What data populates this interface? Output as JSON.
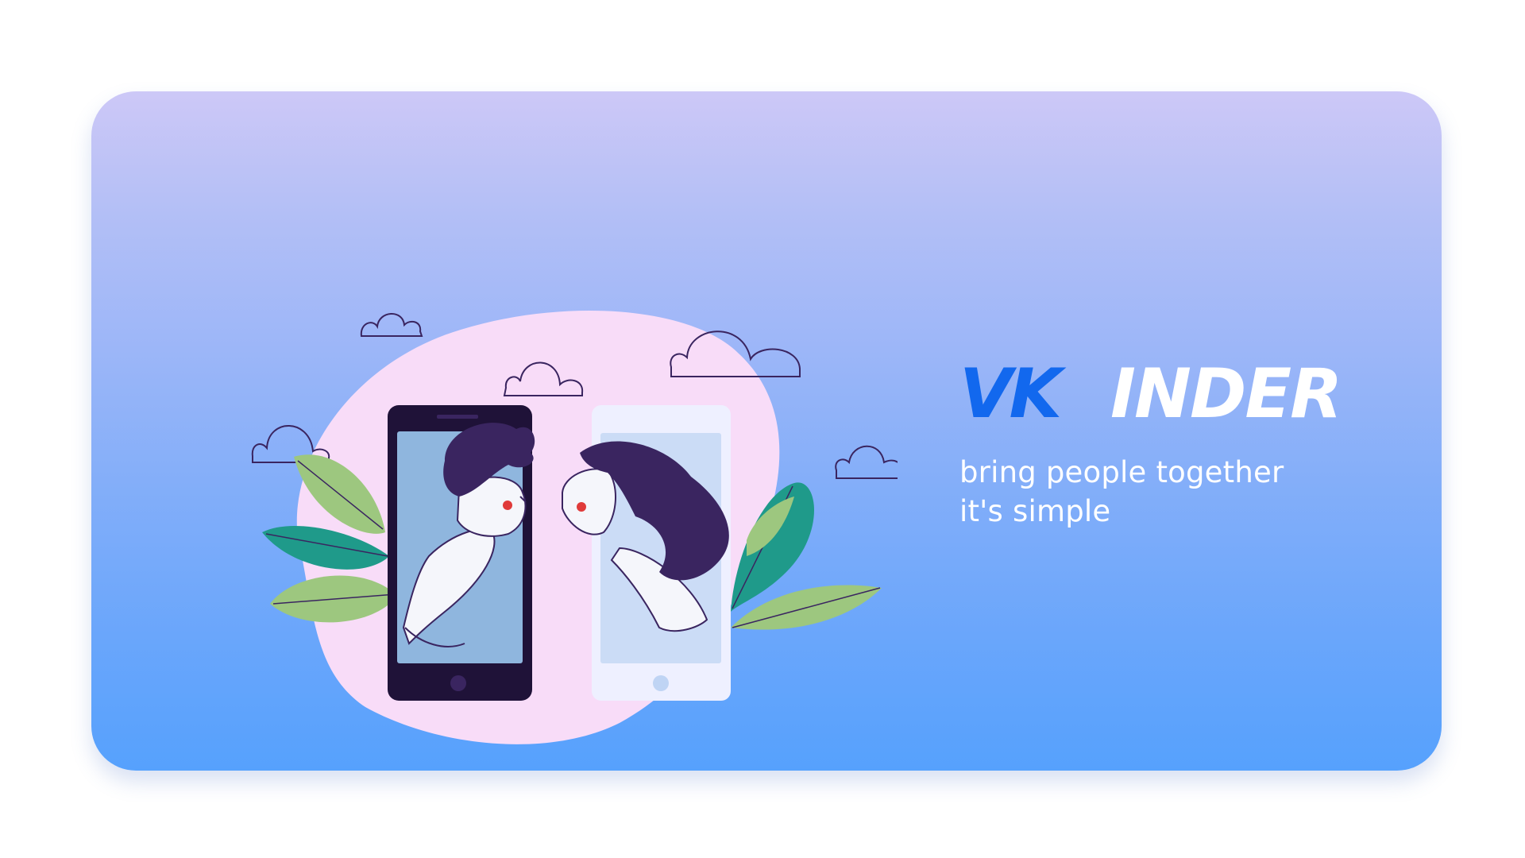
{
  "brand": {
    "logo_part_vk": "VK",
    "logo_part_rest": "INDER",
    "vk_color": "#1268ee",
    "rest_color": "#ffffff"
  },
  "tagline": {
    "line1": "bring people together",
    "line2": "it's simple"
  },
  "colors": {
    "card_top": "#cdc8f7",
    "card_bottom": "#56a1fd",
    "blob": "#f8dcf8",
    "leaf_light": "#9dc77f",
    "leaf_dark": "#1f9a8a",
    "ink": "#3a2560"
  },
  "illustration": {
    "icon": "couple-kissing-through-phones-illustration"
  }
}
